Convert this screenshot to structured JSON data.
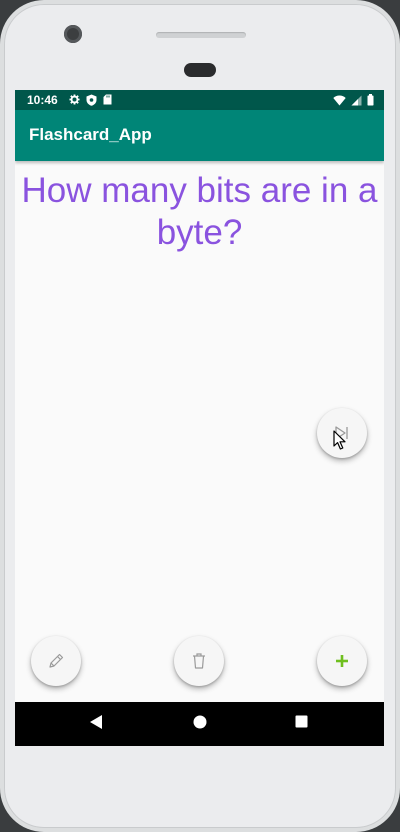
{
  "status_bar": {
    "time": "10:46",
    "left_icons": [
      "settings-icon",
      "shield-icon",
      "sd-card-icon"
    ],
    "right_icons": [
      "wifi-icon",
      "signal-icon",
      "battery-icon"
    ]
  },
  "app_bar": {
    "title": "Flashcard_App",
    "color": "#008577",
    "status_color": "#00574b"
  },
  "card": {
    "question": "How many bits are in a byte?",
    "text_color": "#8a53df"
  },
  "buttons": {
    "next": "next-icon",
    "edit": "pencil-icon",
    "delete": "trash-icon",
    "add": "plus-icon",
    "add_color": "#6fbf1f"
  },
  "nav_bar": [
    "back-icon",
    "home-icon",
    "recents-icon"
  ]
}
